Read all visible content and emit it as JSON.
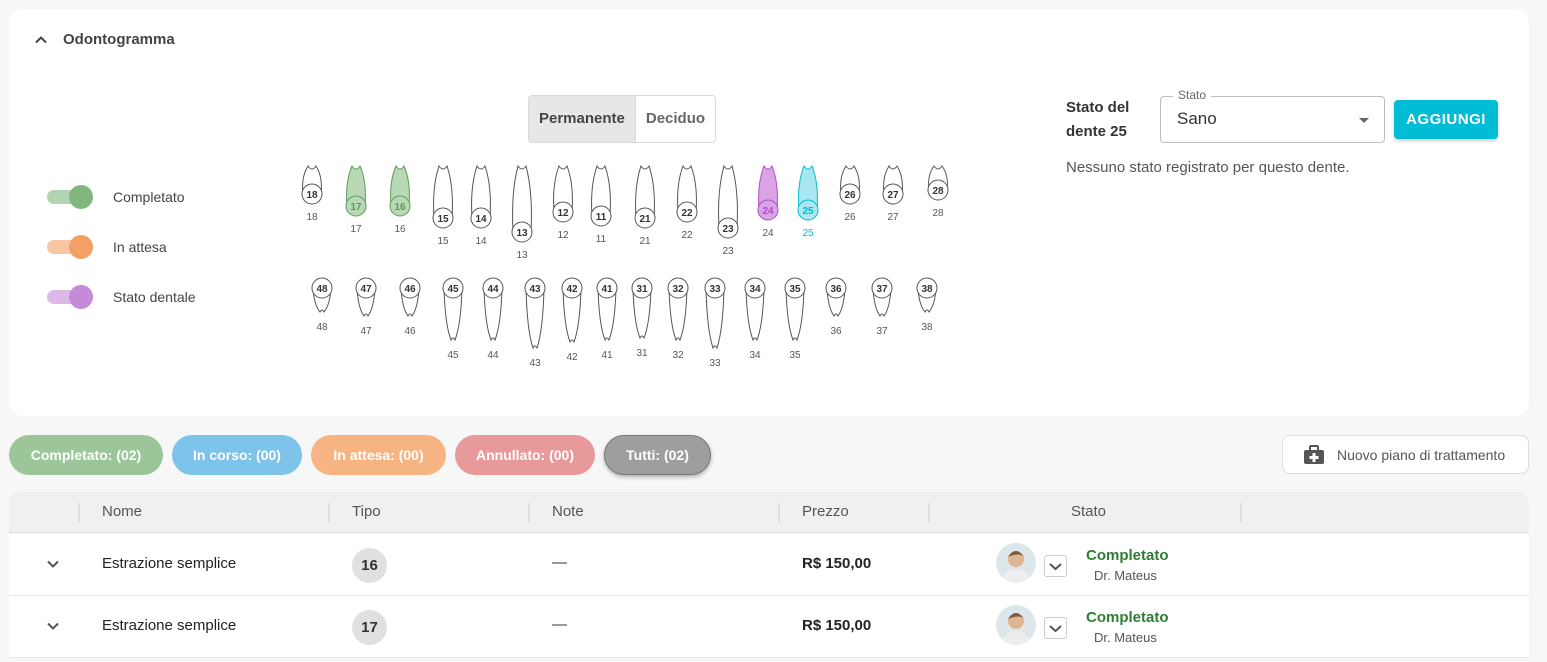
{
  "section": {
    "title": "Odontogramma"
  },
  "legend": [
    {
      "label": "Completato",
      "color": "#81b77f"
    },
    {
      "label": "In attesa",
      "color": "#f3a064"
    },
    {
      "label": "Stato dentale",
      "color": "#c58ad8"
    }
  ],
  "dentition": {
    "options": [
      "Permanente",
      "Deciduo"
    ],
    "selected": "Permanente"
  },
  "teeth": {
    "upper": [
      "18",
      "17",
      "16",
      "15",
      "14",
      "13",
      "12",
      "11",
      "21",
      "22",
      "23",
      "24",
      "25",
      "26",
      "27",
      "28"
    ],
    "lower": [
      "48",
      "47",
      "46",
      "45",
      "44",
      "43",
      "42",
      "41",
      "31",
      "32",
      "33",
      "34",
      "35",
      "36",
      "37",
      "38"
    ],
    "completed": [
      "17",
      "16"
    ],
    "tooth_state": [
      "24"
    ],
    "selected": "25",
    "colors": {
      "completed": "#5a9d57",
      "tooth_state": "#b04ec8",
      "selected": "#00bcd4"
    }
  },
  "tooth_state_panel": {
    "label": "Stato del dente 25",
    "label_line1": "Stato del",
    "label_line2": "dente 25",
    "select_legend": "Stato",
    "select_value": "Sano",
    "add_button": "AGGIUNGI",
    "empty_message": "Nessuno stato registrato per questo dente."
  },
  "filters": [
    {
      "label": "Completato: (02)",
      "color": "#9cc69a"
    },
    {
      "label": "In corso: (00)",
      "color": "#7ec3e9"
    },
    {
      "label": "In attesa: (00)",
      "color": "#f5b481"
    },
    {
      "label": "Annullato: (00)",
      "color": "#e89a9a"
    },
    {
      "label": "Tutti: (02)",
      "color": "#9e9e9e"
    }
  ],
  "new_plan_button": "Nuovo piano di trattamento",
  "table": {
    "columns": [
      "Nome",
      "Tipo",
      "Note",
      "Prezzo",
      "Stato"
    ],
    "rows": [
      {
        "name": "Estrazione semplice",
        "tooth": "16",
        "note": "—",
        "price": "R$ 150,00",
        "status": "Completato",
        "doctor": "Dr. Mateus"
      },
      {
        "name": "Estrazione semplice",
        "tooth": "17",
        "note": "—",
        "price": "R$ 150,00",
        "status": "Completato",
        "doctor": "Dr. Mateus"
      }
    ]
  }
}
